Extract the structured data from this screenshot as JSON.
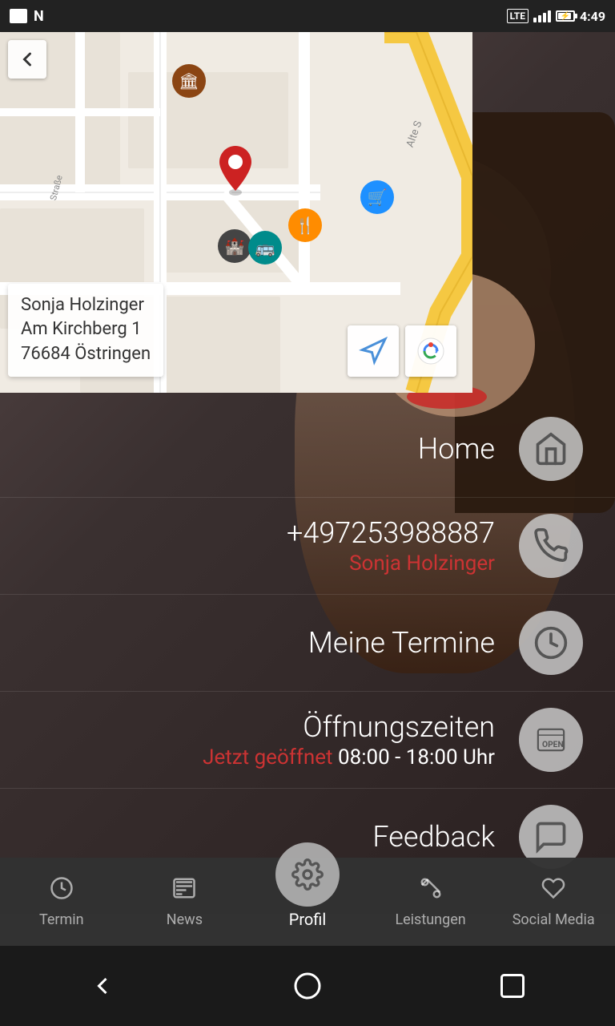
{
  "statusBar": {
    "time": "4:49",
    "lte": "LTE"
  },
  "map": {
    "address_line1": "Sonja Holzinger",
    "address_line2": "Am Kirchberg 1",
    "address_line3": "76684 Östringen"
  },
  "menuItems": [
    {
      "id": "home",
      "title": "Home",
      "subtitle": "",
      "subtitleClass": "",
      "icon": "home"
    },
    {
      "id": "phone",
      "title": "+497253988887",
      "subtitle": "Sonja Holzinger",
      "subtitleClass": "red",
      "icon": "phone"
    },
    {
      "id": "termine",
      "title": "Meine Termine",
      "subtitle": "",
      "subtitleClass": "",
      "icon": "clock"
    },
    {
      "id": "offnungszeiten",
      "title": "Öffnungszeiten",
      "subtitle_open": "Jetzt geöffnet",
      "subtitle_hours": "  08:00 - 18:00 Uhr",
      "subtitleClass": "",
      "icon": "open"
    },
    {
      "id": "feedback",
      "title": "Feedback",
      "subtitle": "",
      "subtitleClass": "",
      "icon": "chat"
    }
  ],
  "bottomNav": [
    {
      "id": "termin",
      "label": "Termin",
      "icon": "clock"
    },
    {
      "id": "news",
      "label": "News",
      "icon": "newspaper"
    },
    {
      "id": "profil",
      "label": "Profil",
      "icon": "gear",
      "isCenter": true
    },
    {
      "id": "leistungen",
      "label": "Leistungen",
      "icon": "scissors"
    },
    {
      "id": "social",
      "label": "Social Media",
      "icon": "heart"
    }
  ]
}
